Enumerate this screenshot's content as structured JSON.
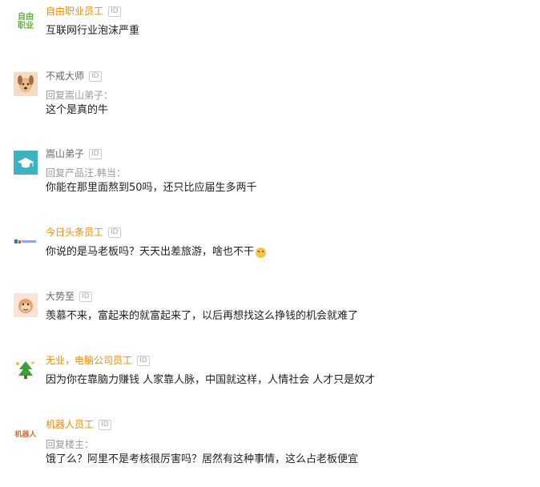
{
  "colors": {
    "vip_orange": "#f08c00",
    "gray_name": "#666666",
    "reply_gray": "#999999",
    "content_text": "#222222",
    "badge_gray": "#aaaaaa"
  },
  "comments": [
    {
      "avatar_text": "自由\n职业",
      "avatar_icon": "logo-icon",
      "username": "自由职业员工",
      "id_badge": "ID",
      "content": "互联网行业泡沫严重"
    },
    {
      "avatar_icon": "dog-icon",
      "username": "不戒大师",
      "id_badge": "ID",
      "reply_to": "回复嵩山弟子：",
      "content": "这个是真的牛"
    },
    {
      "avatar_icon": "graduation-cap-icon",
      "username": "嵩山弟子",
      "id_badge": "ID",
      "reply_to": "回复产品汪.韩当：",
      "content": "你能在那里面熬到50吗，还只比应届生多两千"
    },
    {
      "avatar_text": "今日头条",
      "avatar_icon": "company-logo-icon",
      "username": "今日头条员工",
      "id_badge": "ID",
      "content": "你说的是马老板吗？天天出差旅游，啥也不干",
      "emoji": "grin-emoji-icon"
    },
    {
      "avatar_icon": "monkey-icon",
      "username": "大势至",
      "id_badge": "ID",
      "content": "羡慕不来，富起来的就富起来了，以后再想找这么挣钱的机会就难了"
    },
    {
      "avatar_icon": "tree-icon",
      "username": "无业，电脑公司员工",
      "id_badge": "ID",
      "content": "因为你在靠脑力赚钱 人家靠人脉，中国就这样，人情社会 人才只是奴才"
    },
    {
      "avatar_text": "机器人",
      "avatar_icon": "robot-logo-icon",
      "username": "机器人员工",
      "id_badge": "ID",
      "reply_to": "回复楼主：",
      "content": "饿了么？阿里不是考核很厉害吗？居然有这种事情，这么占老板便宜"
    }
  ]
}
